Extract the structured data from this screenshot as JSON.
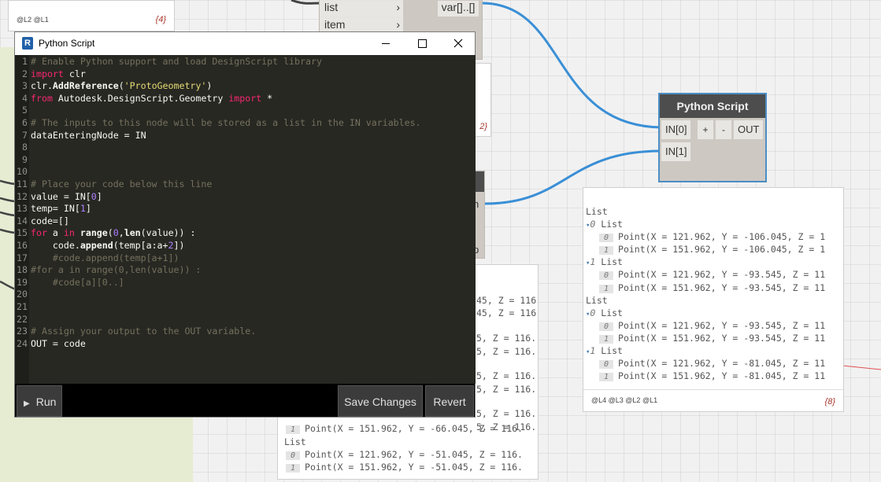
{
  "background": {
    "top_node": {
      "ports": [
        "list",
        "item"
      ],
      "output": "var[]..[]"
    },
    "top_left_watch": {
      "levels": "@L2 @L1",
      "count": "{4}"
    },
    "mid_watch": {
      "count_fragment": "2}"
    },
    "hidden_node": {
      "fragments": [
        "n",
        "p"
      ]
    }
  },
  "editor": {
    "title": "Python Script",
    "logo_letter": "R",
    "buttons": {
      "run": "Run",
      "save": "Save Changes",
      "revert": "Revert"
    },
    "lines": [
      "# Enable Python support and load DesignScript library",
      "import clr",
      "clr.AddReference('ProtoGeometry')",
      "from Autodesk.DesignScript.Geometry import *",
      "",
      "# The inputs to this node will be stored as a list in the IN variables.",
      "dataEnteringNode = IN",
      "",
      "",
      "",
      "# Place your code below this line",
      "value = IN[0]",
      "temp= IN[1]",
      "code=[]",
      "for a in range(0,len(value)) :",
      "    code.append(temp[a:a+2])",
      "    #code.append(temp[a+1])",
      "#for a in range(0,len(value)) :",
      "    #code[a][0..]",
      "",
      "",
      "",
      "# Assign your output to the OUT variable.",
      "OUT = code"
    ]
  },
  "python_node": {
    "title": "Python Script",
    "inputs": [
      "IN[0]",
      "IN[1]"
    ],
    "add_label": "+",
    "remove_label": "-",
    "output": "OUT"
  },
  "right_watch": {
    "header": "List",
    "rows": [
      {
        "kind": "list",
        "idx": "0",
        "label": "List"
      },
      {
        "kind": "item",
        "idx": "0",
        "text": "Point(X = 121.962, Y = -106.045, Z = 1"
      },
      {
        "kind": "item",
        "idx": "1",
        "text": "Point(X = 151.962, Y = -106.045, Z = 1"
      },
      {
        "kind": "list",
        "idx": "1",
        "label": "List"
      },
      {
        "kind": "item",
        "idx": "0",
        "text": "Point(X = 121.962, Y = -93.545, Z = 11"
      },
      {
        "kind": "item",
        "idx": "1",
        "text": "Point(X = 151.962, Y = -93.545, Z = 11"
      },
      {
        "kind": "header",
        "label": "List"
      },
      {
        "kind": "list",
        "idx": "0",
        "label": "List"
      },
      {
        "kind": "item",
        "idx": "0",
        "text": "Point(X = 121.962, Y = -93.545, Z = 11"
      },
      {
        "kind": "item",
        "idx": "1",
        "text": "Point(X = 151.962, Y = -93.545, Z = 11"
      },
      {
        "kind": "list",
        "idx": "1",
        "label": "List"
      },
      {
        "kind": "item",
        "idx": "0",
        "text": "Point(X = 121.962, Y = -81.045, Z = 11"
      },
      {
        "kind": "item",
        "idx": "1",
        "text": "Point(X = 151.962, Y = -81.045, Z = 11"
      }
    ],
    "levels": "@L4 @L3 @L2 @L1",
    "count": "{8}"
  },
  "bottom_watch": {
    "rows": [
      {
        "text": "45, Z = 116"
      },
      {
        "text": "45, Z = 116"
      },
      {
        "text": "5, Z = 116."
      },
      {
        "text": "5, Z = 116."
      },
      {
        "text": "5, Z = 116."
      },
      {
        "text": "5, Z = 116."
      },
      {
        "text": "5, Z = 116."
      },
      {
        "text": "5, Z = 116."
      },
      {
        "idx": "1",
        "text": "Point(X = 151.962, Y = -66.045, Z = 116."
      },
      {
        "header": "List"
      },
      {
        "idx": "0",
        "text": "Point(X = 121.962, Y = -51.045, Z = 116."
      },
      {
        "idx": "1",
        "text": "Point(X = 151.962, Y = -51.045, Z = 116."
      }
    ]
  }
}
